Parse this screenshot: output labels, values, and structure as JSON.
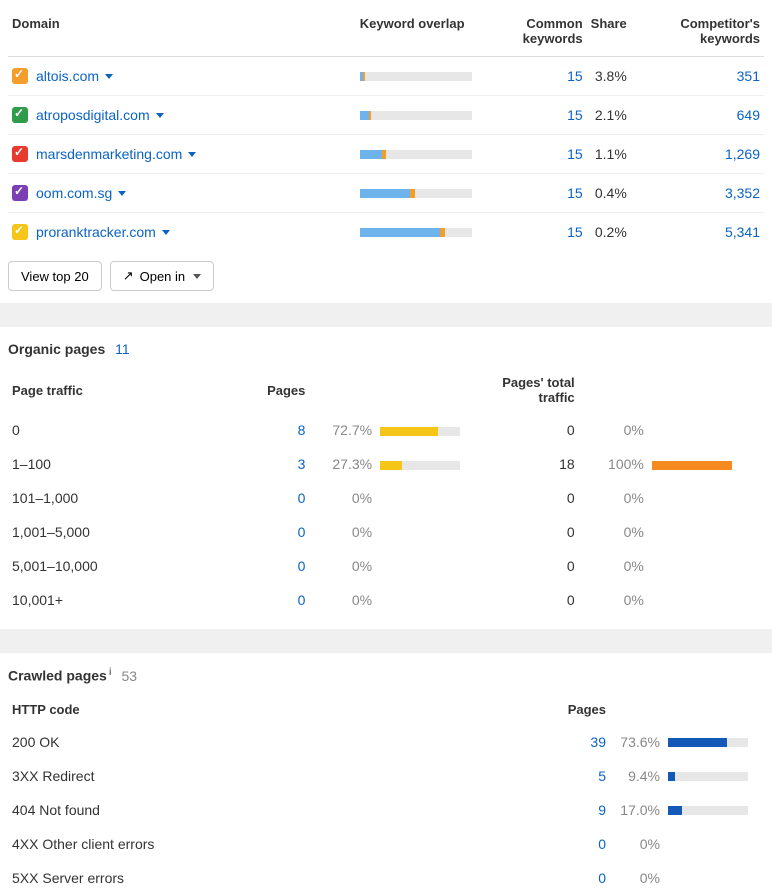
{
  "competitors": {
    "headers": {
      "domain": "Domain",
      "overlap": "Keyword overlap",
      "common": "Common keywords",
      "share": "Share",
      "comp_kw": "Competitor's keywords"
    },
    "rows": [
      {
        "color": "#f59d2a",
        "domain": "altois.com",
        "overlap_main": 3,
        "overlap_end": 2,
        "common": "15",
        "share": "3.8%",
        "comp_kw": "351"
      },
      {
        "color": "#2e9c4b",
        "domain": "atroposdigital.com",
        "overlap_main": 8,
        "overlap_end": 2,
        "common": "15",
        "share": "2.1%",
        "comp_kw": "649"
      },
      {
        "color": "#e63b2e",
        "domain": "marsdenmarketing.com",
        "overlap_main": 20,
        "overlap_end": 3,
        "common": "15",
        "share": "1.1%",
        "comp_kw": "1,269"
      },
      {
        "color": "#7b3fb3",
        "domain": "oom.com.sg",
        "overlap_main": 45,
        "overlap_end": 4,
        "common": "15",
        "share": "0.4%",
        "comp_kw": "3,352"
      },
      {
        "color": "#f5c518",
        "domain": "proranktracker.com",
        "overlap_main": 72,
        "overlap_end": 4,
        "common": "15",
        "share": "0.2%",
        "comp_kw": "5,341"
      }
    ],
    "view_top": "View top 20",
    "open_in": "Open in"
  },
  "organic": {
    "title": "Organic pages",
    "count": "11",
    "headers": {
      "page_traffic": "Page traffic",
      "pages": "Pages",
      "pages_total_traffic": "Pages' total traffic"
    },
    "rows": [
      {
        "label": "0",
        "pages": "8",
        "pages_pct": "72.7%",
        "pages_bar": 73,
        "traffic": "0",
        "traffic_pct": "0%",
        "traffic_bar": 0
      },
      {
        "label": "1–100",
        "pages": "3",
        "pages_pct": "27.3%",
        "pages_bar": 27,
        "traffic": "18",
        "traffic_pct": "100%",
        "traffic_bar": 100
      },
      {
        "label": "101–1,000",
        "pages": "0",
        "pages_pct": "0%",
        "pages_bar": 0,
        "traffic": "0",
        "traffic_pct": "0%",
        "traffic_bar": 0
      },
      {
        "label": "1,001–5,000",
        "pages": "0",
        "pages_pct": "0%",
        "pages_bar": 0,
        "traffic": "0",
        "traffic_pct": "0%",
        "traffic_bar": 0
      },
      {
        "label": "5,001–10,000",
        "pages": "0",
        "pages_pct": "0%",
        "pages_bar": 0,
        "traffic": "0",
        "traffic_pct": "0%",
        "traffic_bar": 0
      },
      {
        "label": "10,001+",
        "pages": "0",
        "pages_pct": "0%",
        "pages_bar": 0,
        "traffic": "0",
        "traffic_pct": "0%",
        "traffic_bar": 0
      }
    ]
  },
  "crawled": {
    "title": "Crawled pages",
    "count": "53",
    "headers": {
      "http_code": "HTTP code",
      "pages": "Pages"
    },
    "rows": [
      {
        "label": "200 OK",
        "pages": "39",
        "pct": "73.6%",
        "bar": 74
      },
      {
        "label": "3XX Redirect",
        "pages": "5",
        "pct": "9.4%",
        "bar": 9
      },
      {
        "label": "404 Not found",
        "pages": "9",
        "pct": "17.0%",
        "bar": 17
      },
      {
        "label": "4XX Other client errors",
        "pages": "0",
        "pct": "0%",
        "bar": 0
      },
      {
        "label": "5XX Server errors",
        "pages": "0",
        "pct": "0%",
        "bar": 0
      }
    ]
  }
}
